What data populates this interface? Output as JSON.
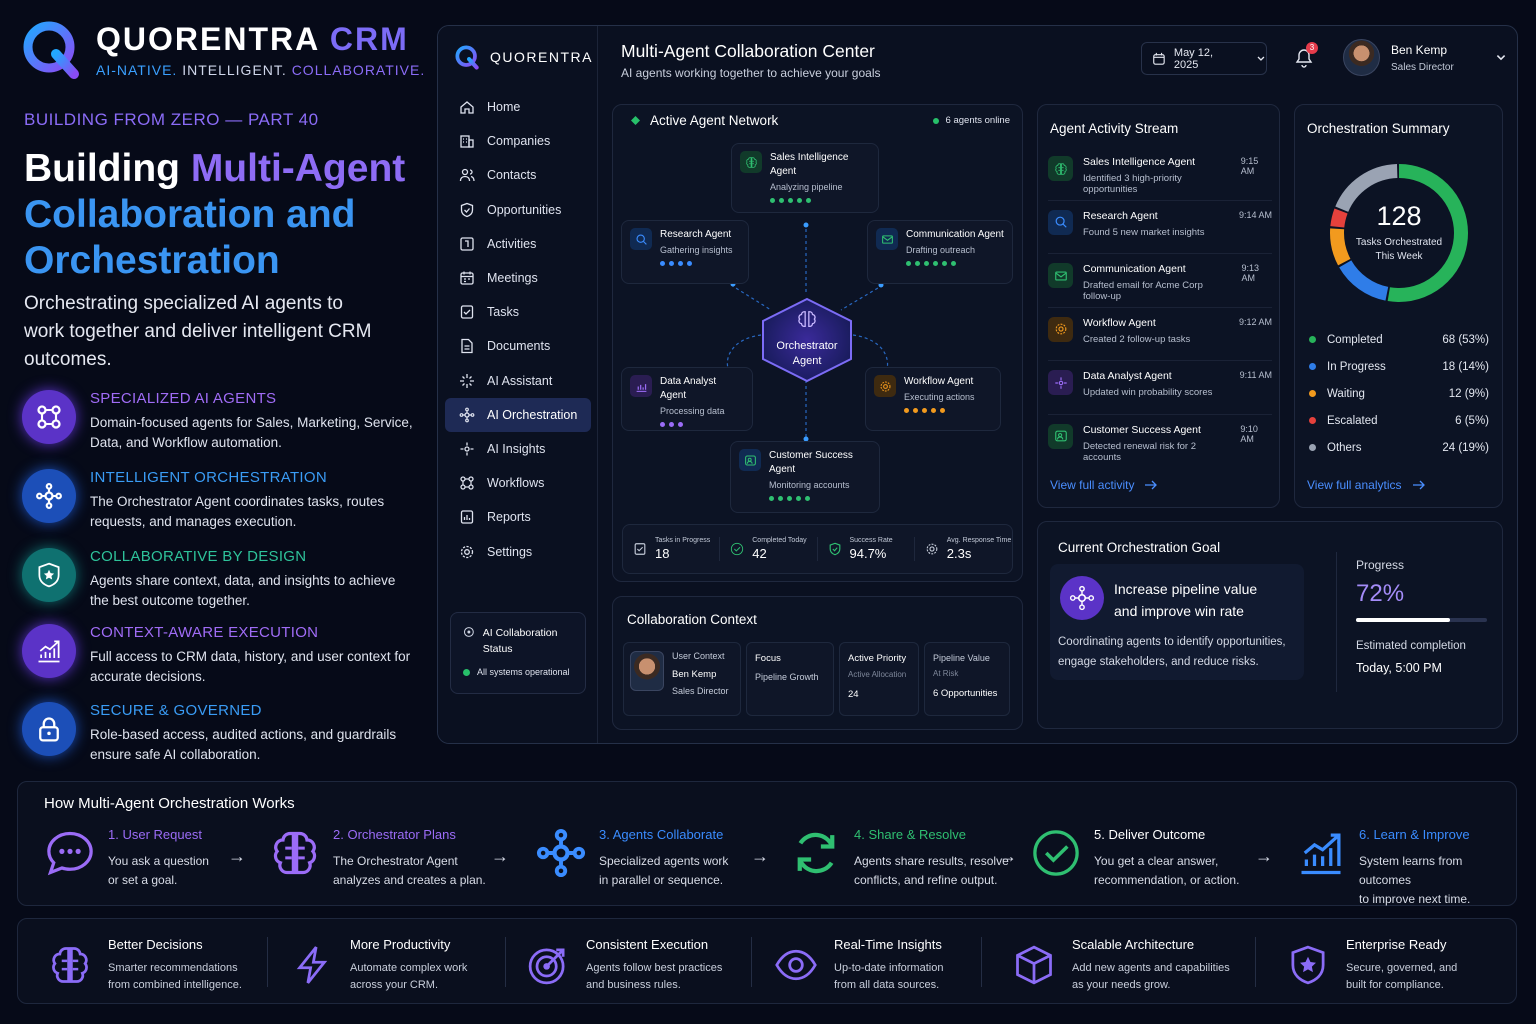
{
  "brand": {
    "name_main": "QUORENTRA",
    "name_crm": "CRM",
    "tag_a": "AI-NATIVE.",
    "tag_b": "INTELLIGENT.",
    "tag_c": "COLLABORATIVE."
  },
  "hero": {
    "series": "BUILDING FROM ZERO — PART 40",
    "title_1": "Building",
    "title_2": "Multi-Agent",
    "title_3": "Collaboration and",
    "title_4": "Orchestration",
    "subtitle": "Orchestrating specialized AI agents to work together and deliver intelligent CRM outcomes."
  },
  "features": [
    {
      "title": "SPECIALIZED AI AGENTS",
      "text": "Domain-focused agents for Sales, Marketing, Service, Data, and Workflow automation.",
      "color": "#a06cf6",
      "bg": "#5b33c7"
    },
    {
      "title": "INTELLIGENT ORCHESTRATION",
      "text": "The Orchestrator Agent coordinates tasks, routes requests, and manages execution.",
      "color": "#3a9cf5",
      "bg": "#1c4fb8"
    },
    {
      "title": "COLLABORATIVE BY DESIGN",
      "text": "Agents share context, data, and insights to achieve the best outcome together.",
      "color": "#2ec29a",
      "bg": "#0f7170"
    },
    {
      "title": "CONTEXT-AWARE EXECUTION",
      "text": "Full access to CRM data, history, and user context for accurate decisions.",
      "color": "#a06cf6",
      "bg": "#5b33c7"
    },
    {
      "title": "SECURE & GOVERNED",
      "text": "Role-based access, audited actions, and guardrails ensure safe AI collaboration.",
      "color": "#3a9cf5",
      "bg": "#1c4fb8"
    }
  ],
  "app": {
    "logo": "QUORENTRA",
    "title": "Multi-Agent Collaboration Center",
    "subtitle": "AI agents working together to achieve your goals",
    "date": "May 12, 2025",
    "notifications": "3",
    "user": {
      "name": "Ben Kemp",
      "role": "Sales Director"
    },
    "nav": [
      {
        "label": "Home",
        "icon": "home-icon"
      },
      {
        "label": "Companies",
        "icon": "building-icon"
      },
      {
        "label": "Contacts",
        "icon": "people-icon"
      },
      {
        "label": "Opportunities",
        "icon": "shield-icon"
      },
      {
        "label": "Activities",
        "icon": "calendar-check-icon"
      },
      {
        "label": "Meetings",
        "icon": "calendar-icon"
      },
      {
        "label": "Tasks",
        "icon": "checklist-icon"
      },
      {
        "label": "Documents",
        "icon": "document-icon"
      },
      {
        "label": "AI Assistant",
        "icon": "sparkle-icon"
      },
      {
        "label": "AI Orchestration",
        "icon": "network-icon"
      },
      {
        "label": "AI Insights",
        "icon": "insights-icon"
      },
      {
        "label": "Workflows",
        "icon": "workflow-icon"
      },
      {
        "label": "Reports",
        "icon": "report-icon"
      },
      {
        "label": "Settings",
        "icon": "gear-icon"
      }
    ],
    "status": {
      "title": "AI Collaboration Status",
      "text": "All systems operational"
    },
    "network": {
      "title": "Active Agent Network",
      "online": "6 agents online",
      "center": {
        "line1": "Orchestrator",
        "line2": "Agent"
      },
      "agents": [
        {
          "name": "Sales Intelligence",
          "name2": "Agent",
          "status": "Analyzing pipeline",
          "color": "#2fbf71",
          "dots": 5
        },
        {
          "name": "Research Agent",
          "name2": "",
          "status": "Gathering insights",
          "color": "#3a8cff",
          "dots": 4
        },
        {
          "name": "Communication Agent",
          "name2": "",
          "status": "Drafting outreach",
          "color": "#2fbf71",
          "dots": 6
        },
        {
          "name": "Data Analyst Agent",
          "name2": "",
          "status": "Processing data",
          "color": "#9b6cf7",
          "dots": 3
        },
        {
          "name": "Workflow Agent",
          "name2": "",
          "status": "Executing actions",
          "color": "#f29a1e",
          "dots": 5
        },
        {
          "name": "Customer Success",
          "name2": "Agent",
          "status": "Monitoring accounts",
          "color": "#2fbf71",
          "dots": 5
        }
      ],
      "stats": [
        {
          "label": "Tasks in Progress",
          "value": "18"
        },
        {
          "label": "Completed Today",
          "value": "42"
        },
        {
          "label": "Success Rate",
          "value": "94.7%"
        },
        {
          "label": "Avg. Response Time",
          "value": "2.3s"
        }
      ]
    },
    "activity": {
      "title": "Agent Activity Stream",
      "items": [
        {
          "name": "Sales Intelligence Agent",
          "desc": "Identified 3 high-priority opportunities",
          "time": "9:15 AM",
          "color": "#2fbf71",
          "bg": "#113a2a"
        },
        {
          "name": "Research Agent",
          "desc": "Found 5 new market insights",
          "time": "9:14 AM",
          "color": "#3a8cff",
          "bg": "#102a52"
        },
        {
          "name": "Communication Agent",
          "desc": "Drafted email for Acme Corp follow-up",
          "time": "9:13 AM",
          "color": "#2fbf71",
          "bg": "#113a2a"
        },
        {
          "name": "Workflow Agent",
          "desc": "Created 2 follow-up tasks",
          "time": "9:12 AM",
          "color": "#f29a1e",
          "bg": "#3e2a10"
        },
        {
          "name": "Data Analyst Agent",
          "desc": "Updated win probability scores",
          "time": "9:11 AM",
          "color": "#9b6cf7",
          "bg": "#2a1d52"
        },
        {
          "name": "Customer Success Agent",
          "desc": "Detected renewal risk for 2 accounts",
          "time": "9:10 AM",
          "color": "#2fbf71",
          "bg": "#113a2a"
        }
      ],
      "link": "View full activity"
    },
    "summary": {
      "title": "Orchestration Summary",
      "total": "128",
      "total_label_1": "Tasks Orchestrated",
      "total_label_2": "This Week",
      "legend": [
        {
          "label": "Completed",
          "value": "68 (53%)",
          "count": 68,
          "color": "#27b35a"
        },
        {
          "label": "In Progress",
          "value": "18 (14%)",
          "count": 18,
          "color": "#2f7de8"
        },
        {
          "label": "Waiting",
          "value": "12 (9%)",
          "count": 12,
          "color": "#f29a1e"
        },
        {
          "label": "Escalated",
          "value": "6 (5%)",
          "count": 6,
          "color": "#e5413c"
        },
        {
          "label": "Others",
          "value": "24 (19%)",
          "count": 24,
          "color": "#9aa3b3"
        }
      ],
      "link": "View full analytics"
    },
    "context": {
      "title": "Collaboration Context",
      "user": {
        "label": "User Context",
        "name": "Ben Kemp",
        "role": "Sales Director"
      },
      "focus": {
        "label": "Focus",
        "value": "Pipeline Growth"
      },
      "priority": {
        "label": "Active Priority",
        "sub": "Active Allocation",
        "value": "24"
      },
      "pipeline": {
        "label": "Pipeline Value",
        "sub": "At Risk",
        "value": "6 Opportunities"
      }
    },
    "goal": {
      "title": "Current Orchestration Goal",
      "headline_1": "Increase pipeline value",
      "headline_2": "and improve win rate",
      "text": "Coordinating agents to identify opportunities, engage stakeholders, and reduce risks.",
      "progress_label": "Progress",
      "progress": "72%",
      "progress_value": 0.72,
      "est_label": "Estimated completion",
      "est_value": "Today, 5:00 PM"
    }
  },
  "flow": {
    "title": "How Multi-Agent Orchestration Works",
    "steps": [
      {
        "title": "1. User Request",
        "text1": "You ask a question",
        "text2": "or set a goal.",
        "color": "#9b6cf7",
        "icon": "chat-bubble-icon"
      },
      {
        "title": "2. Orchestrator Plans",
        "text1": "The Orchestrator Agent",
        "text2": "analyzes and creates a plan.",
        "color": "#9b6cf7",
        "icon": "brain-icon"
      },
      {
        "title": "3. Agents Collaborate",
        "text1": "Specialized agents work",
        "text2": "in parallel or sequence.",
        "color": "#3a8cff",
        "icon": "network-icon"
      },
      {
        "title": "4. Share & Resolve",
        "text1": "Agents share results, resolve",
        "text2": "conflicts, and refine output.",
        "color": "#2fbf71",
        "icon": "refresh-icon"
      },
      {
        "title": "5. Deliver Outcome",
        "text1": "You get a clear answer,",
        "text2": "recommendation, or action.",
        "color": "#ffffff",
        "icon": "check-circle-icon"
      },
      {
        "title": "6. Learn & Improve",
        "text1": "System learns from outcomes",
        "text2": "to improve next time.",
        "color": "#3a8cff",
        "icon": "trend-icon"
      }
    ]
  },
  "benefits": [
    {
      "title": "Better Decisions",
      "text1": "Smarter recommendations",
      "text2": "from combined intelligence.",
      "icon": "brain-icon"
    },
    {
      "title": "More Productivity",
      "text1": "Automate complex work",
      "text2": "across your CRM.",
      "icon": "bolt-icon"
    },
    {
      "title": "Consistent Execution",
      "text1": "Agents follow best practices",
      "text2": "and business rules.",
      "icon": "target-icon"
    },
    {
      "title": "Real-Time Insights",
      "text1": "Up-to-date information",
      "text2": "from all data sources.",
      "icon": "eye-icon"
    },
    {
      "title": "Scalable Architecture",
      "text1": "Add new agents and capabilities",
      "text2": "as your needs grow.",
      "icon": "cube-icon"
    },
    {
      "title": "Enterprise Ready",
      "text1": "Secure, governed, and",
      "text2": "built for compliance.",
      "icon": "shield-star-icon"
    }
  ]
}
